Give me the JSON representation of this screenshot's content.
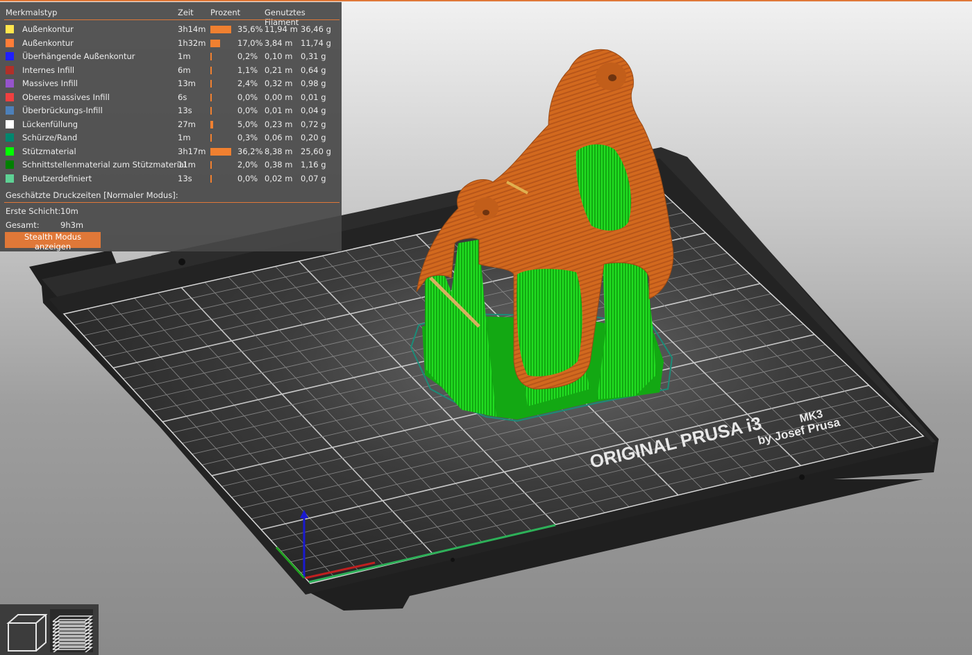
{
  "legend": {
    "header": {
      "feature_type": "Merkmalstyp",
      "time": "Zeit",
      "percent": "Prozent",
      "filament": "Genutztes Filament"
    },
    "rows": [
      {
        "name": "Außenkontur",
        "color": "#FFE64D",
        "time": "3h14m",
        "percent": "35,6%",
        "percent_value": 35.6,
        "length": "11,94 m",
        "weight": "36,46 g"
      },
      {
        "name": "Außenkontur",
        "color": "#FF7D38",
        "time": "1h32m",
        "percent": "17,0%",
        "percent_value": 17.0,
        "length": "3,84 m",
        "weight": "11,74 g"
      },
      {
        "name": "Überhängende Außenkontur",
        "color": "#1F1FFF",
        "time": "1m",
        "percent": "0,2%",
        "percent_value": 0.2,
        "length": "0,10 m",
        "weight": "0,31 g"
      },
      {
        "name": "Internes Infill",
        "color": "#B03029",
        "time": "6m",
        "percent": "1,1%",
        "percent_value": 1.1,
        "length": "0,21 m",
        "weight": "0,64 g"
      },
      {
        "name": "Massives Infill",
        "color": "#9654CC",
        "time": "13m",
        "percent": "2,4%",
        "percent_value": 2.4,
        "length": "0,32 m",
        "weight": "0,98 g"
      },
      {
        "name": "Oberes massives Infill",
        "color": "#F04040",
        "time": "6s",
        "percent": "0,0%",
        "percent_value": 0.0,
        "length": "0,00 m",
        "weight": "0,01 g"
      },
      {
        "name": "Überbrückungs-Infill",
        "color": "#4D80BA",
        "time": "13s",
        "percent": "0,0%",
        "percent_value": 0.0,
        "length": "0,01 m",
        "weight": "0,04 g"
      },
      {
        "name": "Lückenfüllung",
        "color": "#FFFFFF",
        "time": "27m",
        "percent": "5,0%",
        "percent_value": 5.0,
        "length": "0,23 m",
        "weight": "0,72 g"
      },
      {
        "name": "Schürze/Rand",
        "color": "#00876E",
        "time": "1m",
        "percent": "0,3%",
        "percent_value": 0.3,
        "length": "0,06 m",
        "weight": "0,20 g"
      },
      {
        "name": "Stützmaterial",
        "color": "#00FF00",
        "time": "3h17m",
        "percent": "36,2%",
        "percent_value": 36.2,
        "length": "8,38 m",
        "weight": "25,60 g"
      },
      {
        "name": "Schnittstellenmaterial zum Stützmaterial",
        "color": "#008000",
        "time": "11m",
        "percent": "2,0%",
        "percent_value": 2.0,
        "length": "0,38 m",
        "weight": "1,16 g"
      },
      {
        "name": "Benutzerdefiniert",
        "color": "#5ED194",
        "time": "13s",
        "percent": "0,0%",
        "percent_value": 0.0,
        "length": "0,02 m",
        "weight": "0,07 g"
      }
    ],
    "estimate_title": "Geschätzte Druckzeiten [Normaler Modus]:",
    "first_layer_label": "Erste Schicht:",
    "first_layer_value": "10m",
    "total_label": "Gesamt:",
    "total_value": "9h3m",
    "stealth_button": "Stealth Modus anzeigen"
  },
  "bed": {
    "logo_line1": "ORIGINAL PRUSA i3",
    "logo_mk": "MK3",
    "logo_line2": "by Josef Prusa"
  },
  "view_toggle": {
    "icons": [
      "3d-view-cube-icon",
      "layer-preview-icon"
    ]
  },
  "colors": {
    "accent": "#E07838",
    "perimeter": "#D2691E",
    "support": "#1ED21E"
  }
}
